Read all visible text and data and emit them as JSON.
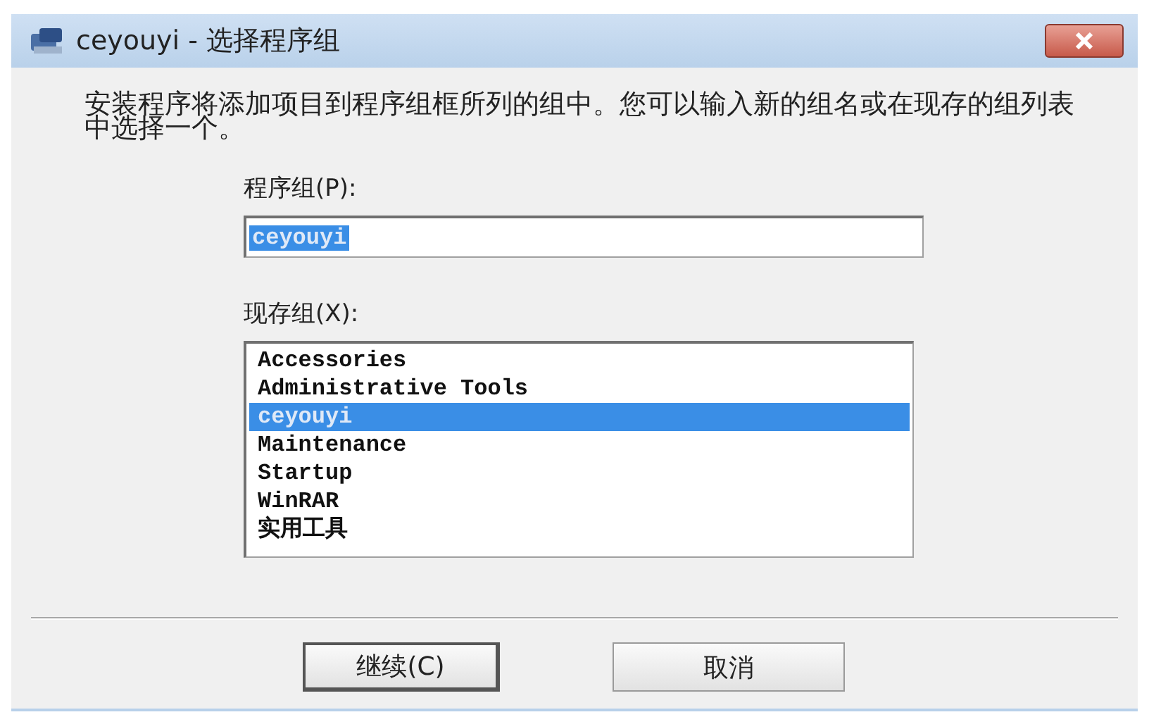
{
  "window": {
    "title": "ceyouyi - 选择程序组"
  },
  "instructions": "安装程序将添加项目到程序组框所列的组中。您可以输入新的组名或在现存的组列表中选择一个。",
  "program_group": {
    "label": "程序组(P):",
    "value": "ceyouyi",
    "value_selected": true
  },
  "existing_groups": {
    "label": "现存组(X):",
    "items": [
      {
        "label": "Accessories",
        "selected": false
      },
      {
        "label": "Administrative Tools",
        "selected": false
      },
      {
        "label": "ceyouyi",
        "selected": true
      },
      {
        "label": "Maintenance",
        "selected": false
      },
      {
        "label": "Startup",
        "selected": false
      },
      {
        "label": "WinRAR",
        "selected": false
      },
      {
        "label": "实用工具",
        "selected": false
      }
    ]
  },
  "buttons": [
    {
      "label": "继续(C)",
      "default": true
    },
    {
      "label": "取消",
      "default": false
    }
  ]
}
